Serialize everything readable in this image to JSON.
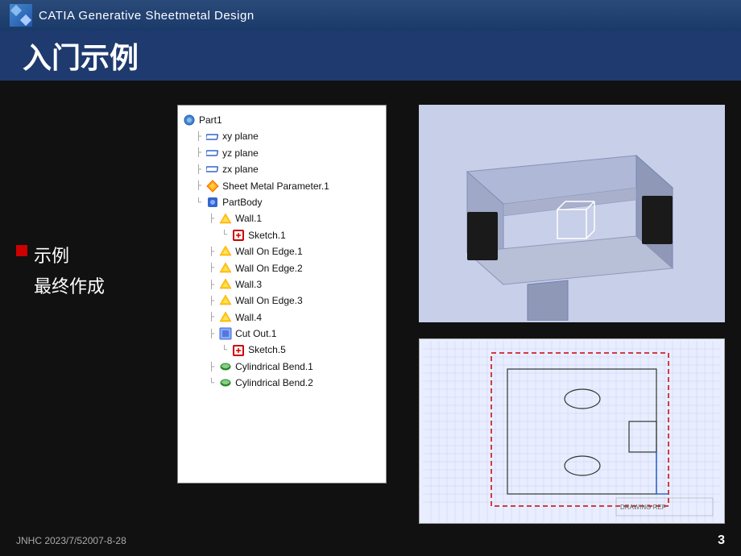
{
  "header": {
    "title": "CATIA  Generative Sheetmetal Design"
  },
  "page": {
    "title": "入门示例",
    "bullet_label": "示例",
    "sub_label": "最终作成",
    "footer_text": "JNHC  2023/7/52007-8-28",
    "page_number": "3"
  },
  "tree": {
    "items": [
      {
        "label": "Part1",
        "indent": 0,
        "icon": "part"
      },
      {
        "label": "xy plane",
        "indent": 1,
        "icon": "plane"
      },
      {
        "label": "yz plane",
        "indent": 1,
        "icon": "plane"
      },
      {
        "label": "zx plane",
        "indent": 1,
        "icon": "plane"
      },
      {
        "label": "Sheet Metal Parameter.1",
        "indent": 1,
        "icon": "sheetmetal"
      },
      {
        "label": "PartBody",
        "indent": 1,
        "icon": "partbody"
      },
      {
        "label": "Wall.1",
        "indent": 2,
        "icon": "wall"
      },
      {
        "label": "Sketch.1",
        "indent": 3,
        "icon": "sketch"
      },
      {
        "label": "Wall On Edge.1",
        "indent": 2,
        "icon": "wall"
      },
      {
        "label": "Wall On Edge.2",
        "indent": 2,
        "icon": "wall"
      },
      {
        "label": "Wall.3",
        "indent": 2,
        "icon": "wall"
      },
      {
        "label": "Wall On Edge.3",
        "indent": 2,
        "icon": "wall"
      },
      {
        "label": "Wall.4",
        "indent": 2,
        "icon": "wall"
      },
      {
        "label": "Cut Out.1",
        "indent": 2,
        "icon": "cutout"
      },
      {
        "label": "Sketch.5",
        "indent": 3,
        "icon": "sketch"
      },
      {
        "label": "Cylindrical Bend.1",
        "indent": 2,
        "icon": "cylbend"
      },
      {
        "label": "Cylindrical Bend.2",
        "indent": 2,
        "icon": "cylbend"
      }
    ]
  }
}
